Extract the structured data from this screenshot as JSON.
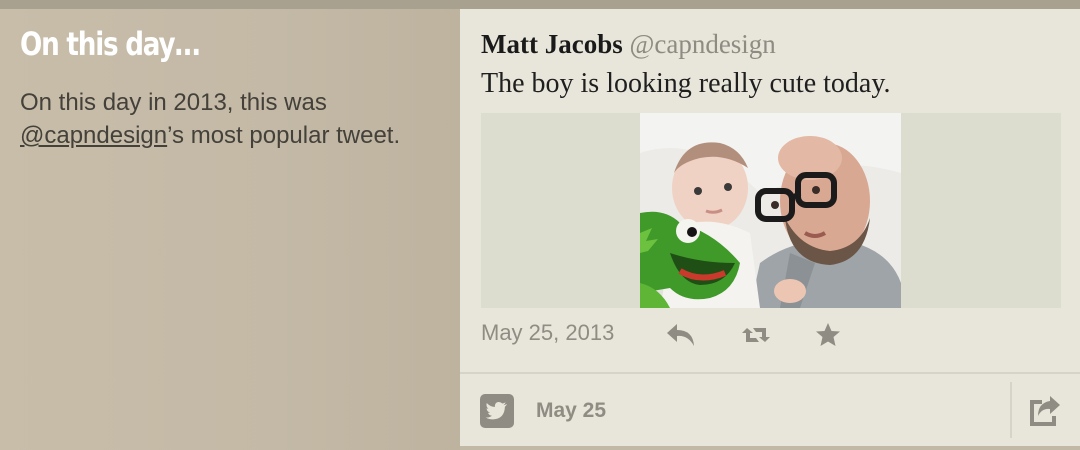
{
  "panel": {
    "title": "On this day…",
    "desc_before": "On this day in 2013, this was ",
    "desc_mention": "@capndesign",
    "desc_after": "’s most popular tweet."
  },
  "tweet": {
    "author_name": "Matt Jacobs",
    "author_handle": "@capndesign",
    "text": "The boy is looking really cute today.",
    "date": "May 25, 2013"
  },
  "actions": [
    {
      "name": "reply",
      "icon": "reply-icon"
    },
    {
      "name": "retweet",
      "icon": "retweet-icon"
    },
    {
      "name": "favorite",
      "icon": "star-icon"
    }
  ],
  "footer": {
    "date": "May 25",
    "service_icon": "twitter-bird-icon",
    "share_icon": "share-icon"
  },
  "colors": {
    "left_panel_bg": "#c4baa7",
    "card_bg": "#e8e6da",
    "icon_gray": "#8f8c84"
  }
}
